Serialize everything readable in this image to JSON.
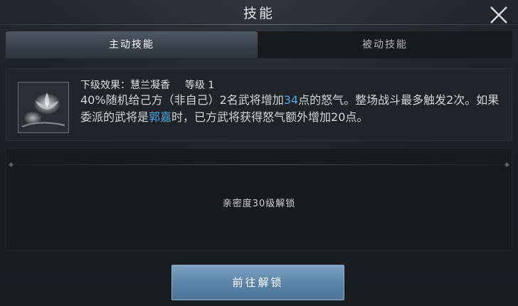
{
  "window": {
    "title": "技能"
  },
  "icons": {
    "close": "close-icon",
    "skill": "lotus-skill-icon"
  },
  "tabs": [
    {
      "label": "主动技能",
      "active": true
    },
    {
      "label": "被动技能",
      "active": false
    }
  ],
  "skill": {
    "effect_label": "下级效果：慧兰凝香",
    "level_label": "等级 1",
    "desc_part1": "40%随机给己方（非自己）2名武将增加",
    "desc_value": "34",
    "desc_part2": "点的怒气。整场战斗最多触发2次。如果委派的武将是",
    "desc_name": "郭嘉",
    "desc_part3": "时，已方武将获得怒气额外增加20点。"
  },
  "lock": {
    "text": "亲密度30级解锁"
  },
  "button": {
    "label": "前往解锁"
  },
  "colors": {
    "highlight": "#4fa6e6",
    "button": "#5d85a8",
    "background": "#1c1f24"
  }
}
